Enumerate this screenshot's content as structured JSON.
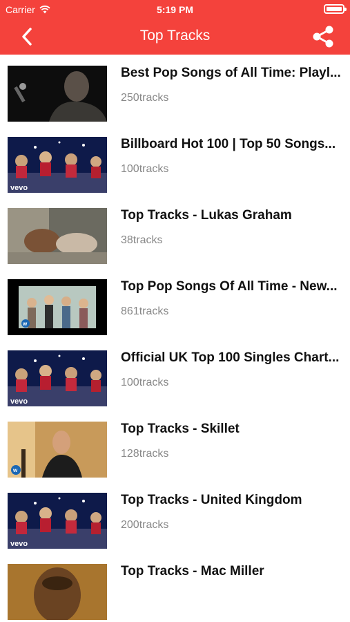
{
  "status_bar": {
    "carrier": "Carrier",
    "time": "5:19 PM"
  },
  "nav": {
    "title": "Top Tracks",
    "back_icon": "chevron-left-icon",
    "share_icon": "share-icon"
  },
  "colors": {
    "accent": "#f4423c"
  },
  "playlists": [
    {
      "title": "Best Pop Songs of All Time: Playl...",
      "count": "250tracks",
      "thumb": "singer-mic"
    },
    {
      "title": "Billboard Hot 100 | Top 50 Songs...",
      "count": "100tracks",
      "thumb": "vevo-christmas",
      "badge": "vevo"
    },
    {
      "title": "Top Tracks - Lukas Graham",
      "count": "38tracks",
      "thumb": "couple"
    },
    {
      "title": "Top Pop Songs Of All Time - New...",
      "count": "861tracks",
      "thumb": "girls-group"
    },
    {
      "title": "Official UK Top 100 Singles Chart...",
      "count": "100tracks",
      "thumb": "vevo-christmas",
      "badge": "vevo"
    },
    {
      "title": "Top Tracks - Skillet",
      "count": "128tracks",
      "thumb": "skillet-singer"
    },
    {
      "title": "Top Tracks - United Kingdom",
      "count": "200tracks",
      "thumb": "vevo-christmas",
      "badge": "vevo"
    },
    {
      "title": "Top Tracks - Mac Miller",
      "count": "",
      "thumb": "face-closeup"
    }
  ]
}
